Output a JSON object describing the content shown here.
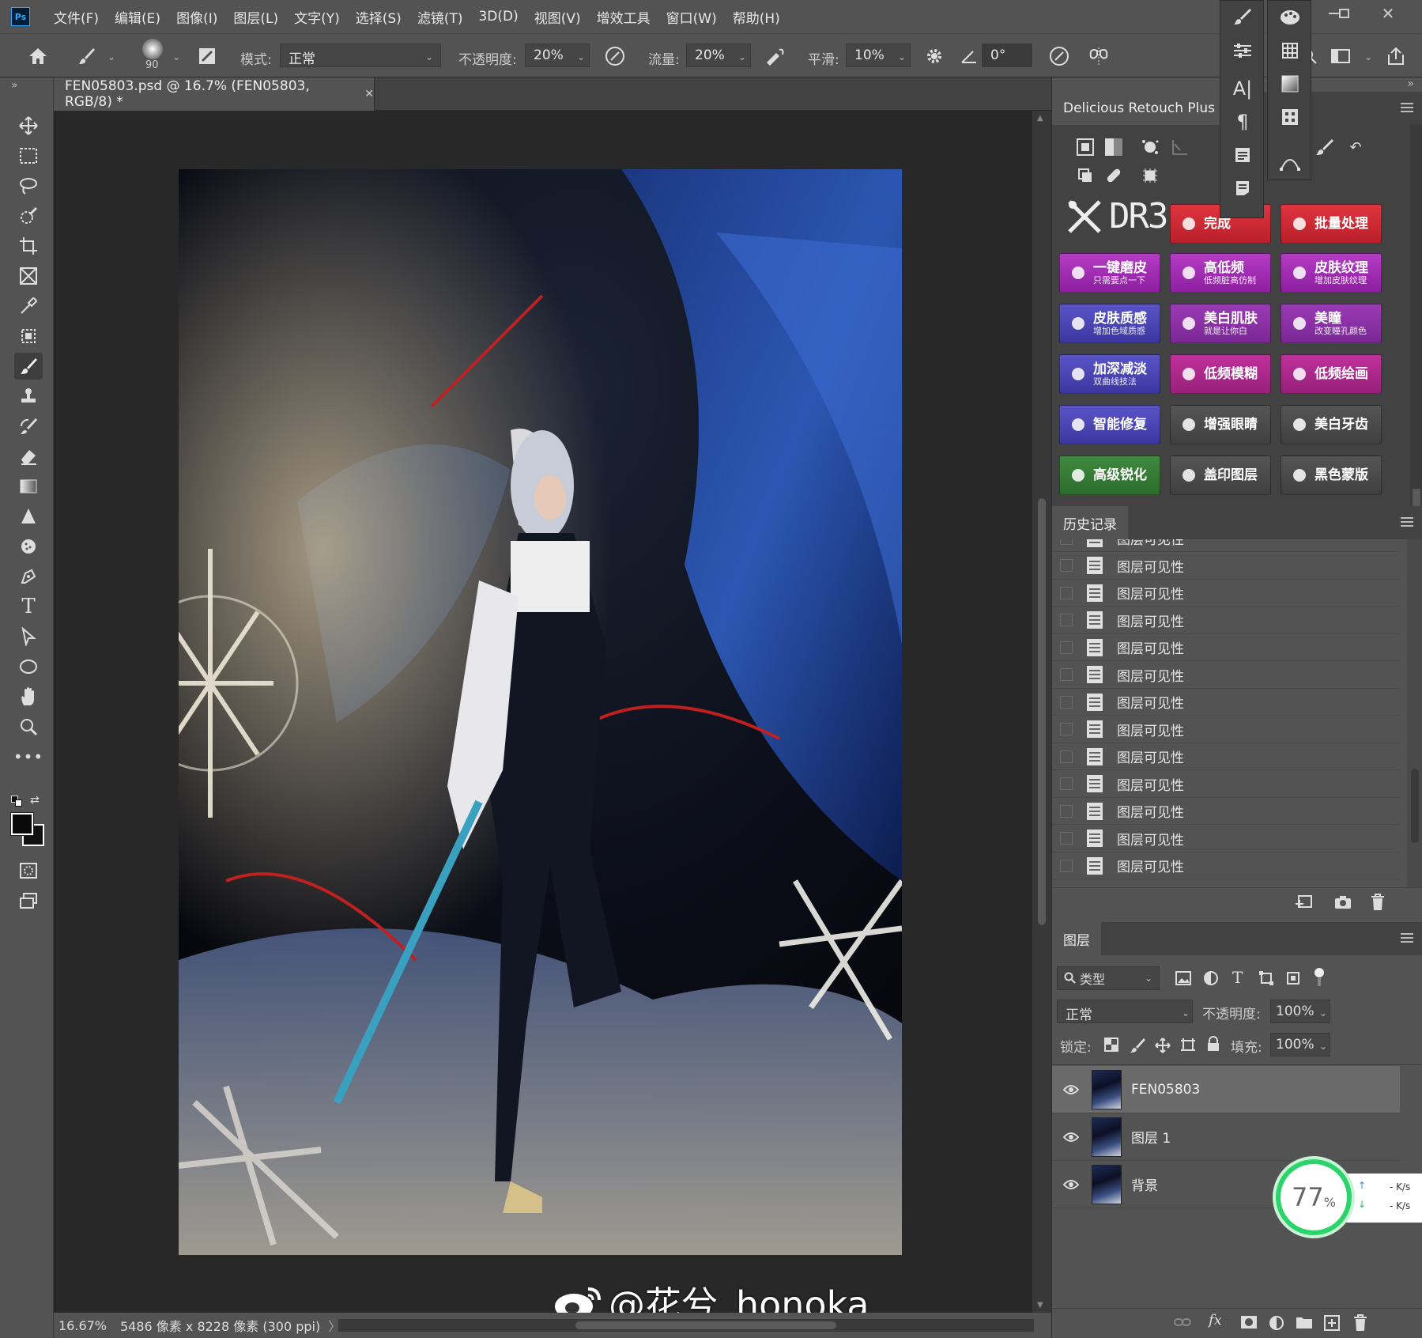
{
  "app": {
    "logo": "Ps"
  },
  "menu": [
    "文件(F)",
    "编辑(E)",
    "图像(I)",
    "图层(L)",
    "文字(Y)",
    "选择(S)",
    "滤镜(T)",
    "3D(D)",
    "视图(V)",
    "增效工具",
    "窗口(W)",
    "帮助(H)"
  ],
  "options": {
    "brush_size": "90",
    "mode_label": "模式:",
    "mode_value": "正常",
    "opacity_label": "不透明度:",
    "opacity_value": "20%",
    "flow_label": "流量:",
    "flow_value": "20%",
    "smooth_label": "平滑:",
    "smooth_value": "10%",
    "angle_value": "0°"
  },
  "document": {
    "tab_title": "FEN05803.psd @ 16.7% (FEN05803, RGB/8) *",
    "zoom": "16.67%",
    "dimensions": "5486 像素 x 8228 像素 (300 ppi)"
  },
  "watermark": "@花兮_honoka",
  "dr_panel": {
    "title": "Delicious Retouch Plus",
    "logo_text": "DR3",
    "buttons": [
      {
        "id": "complete",
        "t1": "完成",
        "t2": "",
        "color": "red"
      },
      {
        "id": "batch",
        "t1": "批量处理",
        "t2": "",
        "color": "red"
      },
      {
        "id": "one-click-skin",
        "t1": "一键磨皮",
        "t2": "只需要点一下",
        "color": "pur"
      },
      {
        "id": "hi-lo-freq",
        "t1": "高低频",
        "t2": "低频脏高仿制",
        "color": "pur"
      },
      {
        "id": "skin-texture",
        "t1": "皮肤纹理",
        "t2": "增加皮肤纹理",
        "color": "pur"
      },
      {
        "id": "skin-quality",
        "t1": "皮肤质感",
        "t2": "增加色域质感",
        "color": "blu"
      },
      {
        "id": "whiten-skin",
        "t1": "美白肌肤",
        "t2": "就是让你白",
        "color": "vio"
      },
      {
        "id": "pupil",
        "t1": "美瞳",
        "t2": "改变瞳孔颜色",
        "color": "vio"
      },
      {
        "id": "dodge-burn",
        "t1": "加深减淡",
        "t2": "双曲线技法",
        "color": "blu"
      },
      {
        "id": "low-freq-blur",
        "t1": "低频模糊",
        "t2": "",
        "color": "mag"
      },
      {
        "id": "low-freq-paint",
        "t1": "低频绘画",
        "t2": "",
        "color": "mag"
      },
      {
        "id": "smart-repair",
        "t1": "智能修复",
        "t2": "",
        "color": "blu"
      },
      {
        "id": "enhance-eyes",
        "t1": "增强眼睛",
        "t2": "",
        "color": "gry"
      },
      {
        "id": "whiten-teeth",
        "t1": "美白牙齿",
        "t2": "",
        "color": "gry"
      },
      {
        "id": "sharpen",
        "t1": "高级锐化",
        "t2": "",
        "color": "grn"
      },
      {
        "id": "stamp-layer",
        "t1": "盖印图层",
        "t2": "",
        "color": "gry"
      },
      {
        "id": "black-mask",
        "t1": "黑色蒙版",
        "t2": "",
        "color": "gry"
      }
    ]
  },
  "history": {
    "title": "历史记录",
    "items": [
      "图层可见性",
      "图层可见性",
      "图层可见性",
      "图层可见性",
      "图层可见性",
      "图层可见性",
      "图层可见性",
      "图层可见性",
      "图层可见性",
      "图层可见性",
      "图层可见性",
      "图层可见性",
      "图层可见性"
    ]
  },
  "layers": {
    "title": "图层",
    "filter_label": "类型",
    "blend_mode": "正常",
    "opacity_label": "不透明度:",
    "opacity_value": "100%",
    "lock_label": "锁定:",
    "fill_label": "填充:",
    "fill_value": "100%",
    "items": [
      {
        "name": "FEN05803",
        "selected": true
      },
      {
        "name": "图层 1",
        "selected": false
      },
      {
        "name": "背景",
        "selected": false
      }
    ]
  },
  "net_widget": {
    "percent": "77",
    "unit": "%",
    "up": "- K/s",
    "down": "- K/s"
  }
}
